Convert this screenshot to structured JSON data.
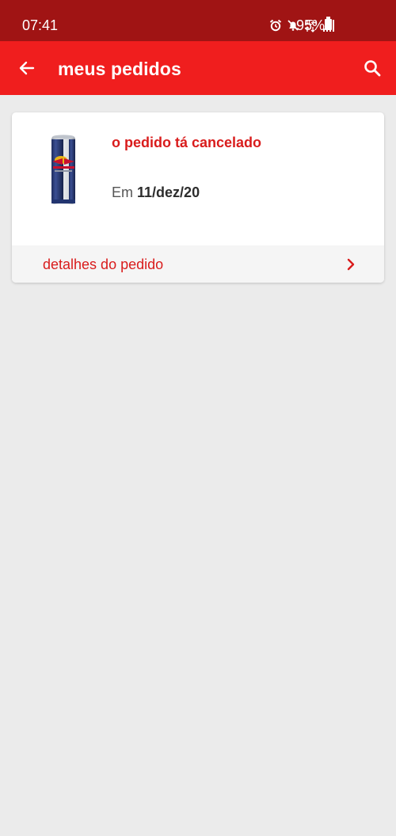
{
  "status_bar": {
    "time": "07:41",
    "network_label": "4G+",
    "battery": "95%",
    "icons": [
      "alarm-icon",
      "mute-icon",
      "network-icon",
      "signal-icon",
      "battery-icon"
    ]
  },
  "app_bar": {
    "title": "meus pedidos",
    "back_icon": "arrow-left-icon",
    "search_icon": "search-icon"
  },
  "orders": [
    {
      "status": "o pedido tá cancelado",
      "date_prefix": "Em",
      "date": "11/dez/20",
      "details_label": "detalhes do pedido",
      "product_image": "energy-drink-can"
    }
  ],
  "colors": {
    "status_bar": "#a01414",
    "app_bar": "#f01e1e",
    "accent": "#d91c1c",
    "background": "#ebebeb"
  }
}
